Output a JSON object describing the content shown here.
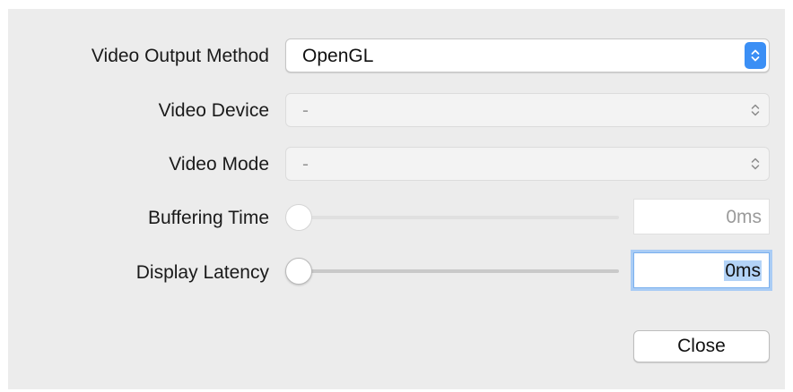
{
  "dialog": {
    "video_output_method": {
      "label": "Video Output Method",
      "value": "OpenGL",
      "enabled": true
    },
    "video_device": {
      "label": "Video Device",
      "value": "-",
      "enabled": false
    },
    "video_mode": {
      "label": "Video Mode",
      "value": "-",
      "enabled": false
    },
    "buffering_time": {
      "label": "Buffering Time",
      "value": "0ms",
      "slider_level": 0,
      "enabled": false
    },
    "display_latency": {
      "label": "Display Latency",
      "value": "0ms",
      "slider_level": 0,
      "enabled": true,
      "focused": true
    },
    "close_label": "Close"
  },
  "icons": {
    "select_stepper": "up-down-chevron-icon",
    "slider_knob": "slider-knob"
  },
  "colors": {
    "accent": "#3b8ff5",
    "dialog_background": "#ececec",
    "focus_ring": "#a9ccf5"
  }
}
